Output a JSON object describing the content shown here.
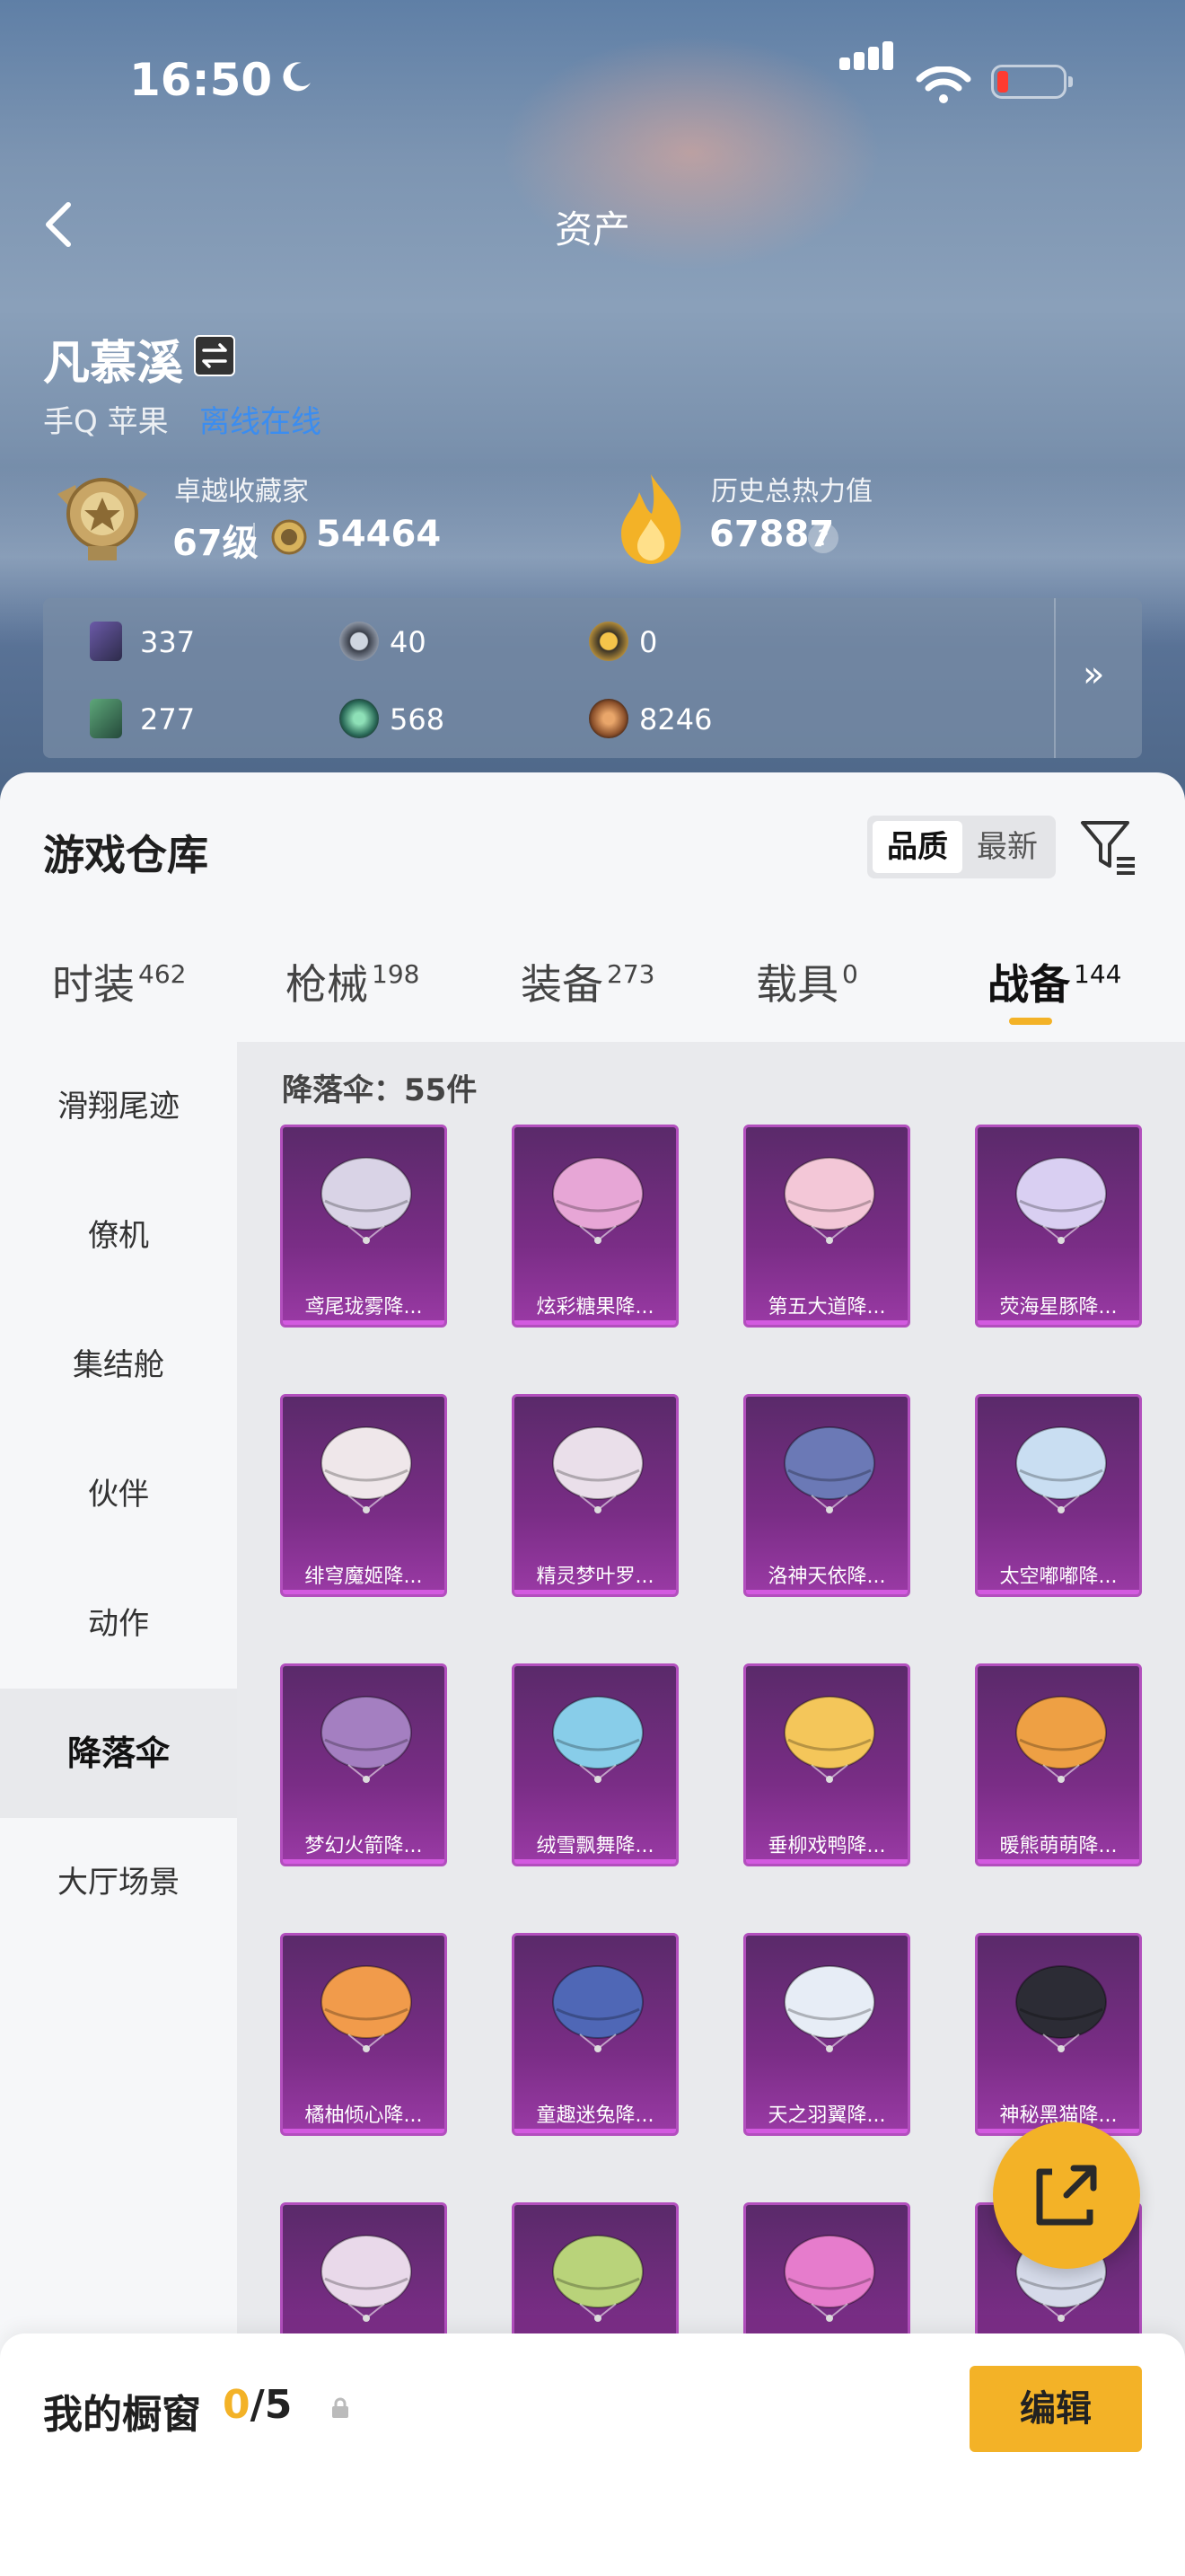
{
  "status": {
    "time": "16:50"
  },
  "nav": {
    "title": "资产"
  },
  "profile": {
    "name": "凡慕溪",
    "platform": "手Q 苹果",
    "online": "离线在线",
    "rank_label": "卓越收藏家",
    "level": "67级",
    "coins": "54464",
    "heat_label": "历史总热力值",
    "heat_value": "67887",
    "help": "?"
  },
  "resources": [
    {
      "icon": "card-purple-icon",
      "value": "337"
    },
    {
      "icon": "coin-silver-icon",
      "value": "40"
    },
    {
      "icon": "coin-gold-icon",
      "value": "0"
    },
    {
      "icon": "card-green-icon",
      "value": "277"
    },
    {
      "icon": "orb-green-icon",
      "value": "568"
    },
    {
      "icon": "orb-bronze-icon",
      "value": "8246"
    }
  ],
  "more": "»",
  "warehouse": {
    "title": "游戏仓库",
    "sort_quality": "品质",
    "sort_latest": "最新",
    "tabs": [
      {
        "label": "时装",
        "count": "462"
      },
      {
        "label": "枪械",
        "count": "198"
      },
      {
        "label": "装备",
        "count": "273"
      },
      {
        "label": "载具",
        "count": "0"
      },
      {
        "label": "战备",
        "count": "144"
      }
    ],
    "side": [
      "滑翔尾迹",
      "僚机",
      "集结舱",
      "伙伴",
      "动作",
      "降落伞",
      "大厅场景"
    ],
    "count_line": "降落伞：55件",
    "items": [
      {
        "name": "鸢尾珑雾降...",
        "color": "#d9d3e6"
      },
      {
        "name": "炫彩糖果降...",
        "color": "#e7a6d6"
      },
      {
        "name": "第五大道降...",
        "color": "#f3c7d7"
      },
      {
        "name": "荧海星豚降...",
        "color": "#d9cff2"
      },
      {
        "name": "绯穹魔姬降...",
        "color": "#efe7ea"
      },
      {
        "name": "精灵梦叶罗...",
        "color": "#eadfea"
      },
      {
        "name": "洛神天依降...",
        "color": "#6b79b6"
      },
      {
        "name": "太空嘟嘟降...",
        "color": "#c9def2"
      },
      {
        "name": "梦幻火箭降...",
        "color": "#a47fc1"
      },
      {
        "name": "绒雪飘舞降...",
        "color": "#88cde9"
      },
      {
        "name": "垂柳戏鸭降...",
        "color": "#f4c65a"
      },
      {
        "name": "暖熊萌萌降...",
        "color": "#eea044"
      },
      {
        "name": "橘柚倾心降...",
        "color": "#f19b4b"
      },
      {
        "name": "童趣迷兔降...",
        "color": "#4f67b6"
      },
      {
        "name": "天之羽翼降...",
        "color": "#e7edf6"
      },
      {
        "name": "神秘黑猫降...",
        "color": "#2c2c35"
      },
      {
        "name": "",
        "color": "#e9d9ea"
      },
      {
        "name": "",
        "color": "#b9d37a"
      },
      {
        "name": "",
        "color": "#e67ccc"
      },
      {
        "name": "",
        "color": "#d6dbea"
      }
    ]
  },
  "showcase": {
    "title": "我的橱窗",
    "current": "0",
    "total": "/5",
    "edit": "编辑"
  },
  "colors": {
    "accent": "#f3b227",
    "card": "#7a2d86"
  }
}
